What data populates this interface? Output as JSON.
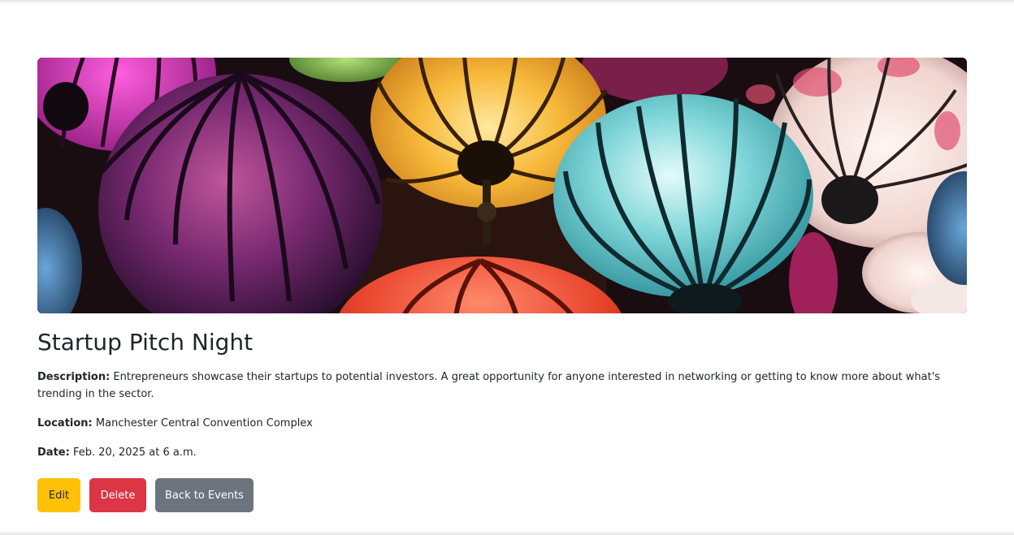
{
  "event": {
    "image_alt": "Colorful paper lanterns",
    "title": "Startup Pitch Night",
    "description_label": "Description:",
    "description": "Entrepreneurs showcase their startups to potential investors. A great opportunity for anyone interested in networking or getting to know more about what's trending in the sector.",
    "location_label": "Location:",
    "location": "Manchester Central Convention Complex",
    "date_label": "Date:",
    "date": "Feb. 20, 2025 at 6 a.m."
  },
  "actions": {
    "edit_label": "Edit",
    "delete_label": "Delete",
    "back_label": "Back to Events"
  },
  "colors": {
    "edit": "#ffc107",
    "delete": "#dc3545",
    "back": "#6c757d",
    "text": "#212529"
  }
}
